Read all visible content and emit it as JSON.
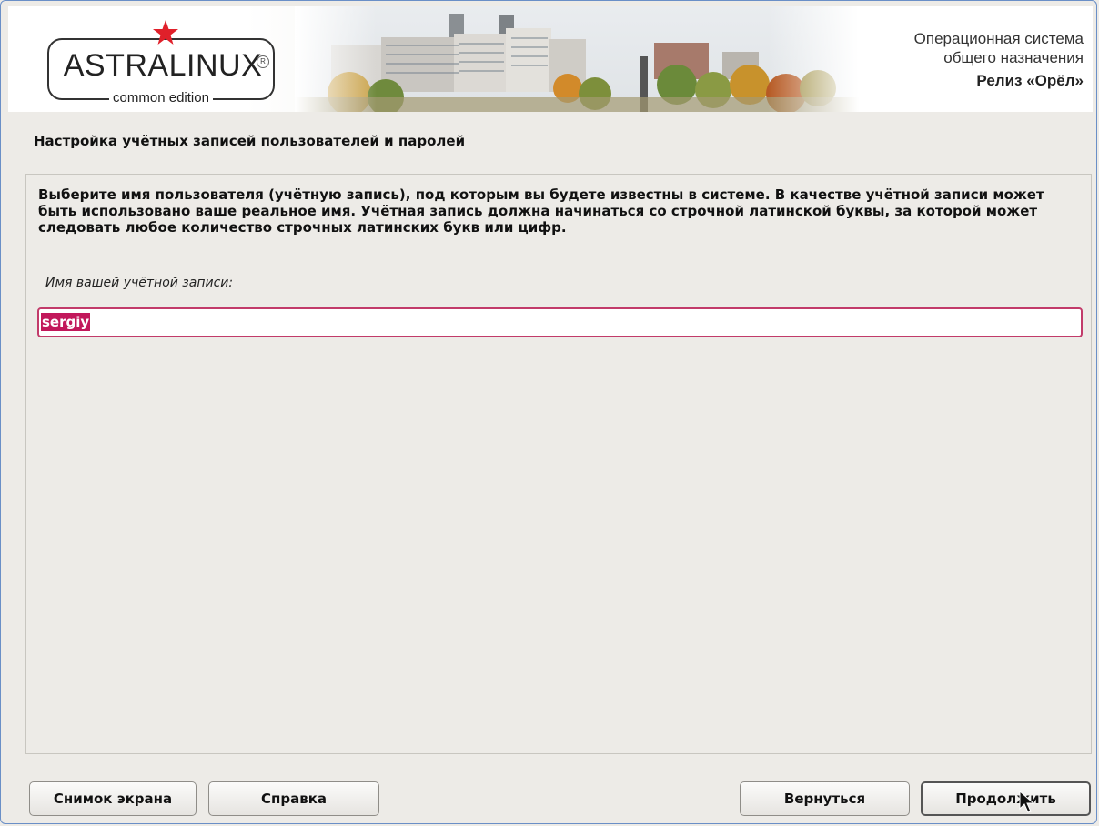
{
  "banner": {
    "logo_main": "ASTRALINUX",
    "logo_sub": "common edition",
    "logo_reg": "R",
    "release_line1": "Операционная система",
    "release_line2": "общего назначения",
    "release_line3": "Релиз «Орёл»"
  },
  "page": {
    "title": "Настройка учётных записей пользователей и паролей",
    "description": "Выберите имя пользователя (учётную запись), под которым вы будете известны в системе. В качестве учётной записи может быть использовано ваше реальное имя. Учётная запись должна начинаться со строчной латинской буквы, за которой может следовать любое количество строчных латинских букв или цифр.",
    "field_label": "Имя вашей учётной записи:",
    "username_value": "sergiy"
  },
  "buttons": {
    "screenshot": "Снимок экрана",
    "help": "Справка",
    "back": "Вернуться",
    "continue": "Продолжить"
  },
  "colors": {
    "accent": "#c2185b",
    "input_border": "#c23b6a",
    "background": "#edebe7",
    "logo_star": "#e0202a"
  },
  "icons": [
    "star-icon",
    "registered-icon",
    "mouse-cursor-icon"
  ]
}
